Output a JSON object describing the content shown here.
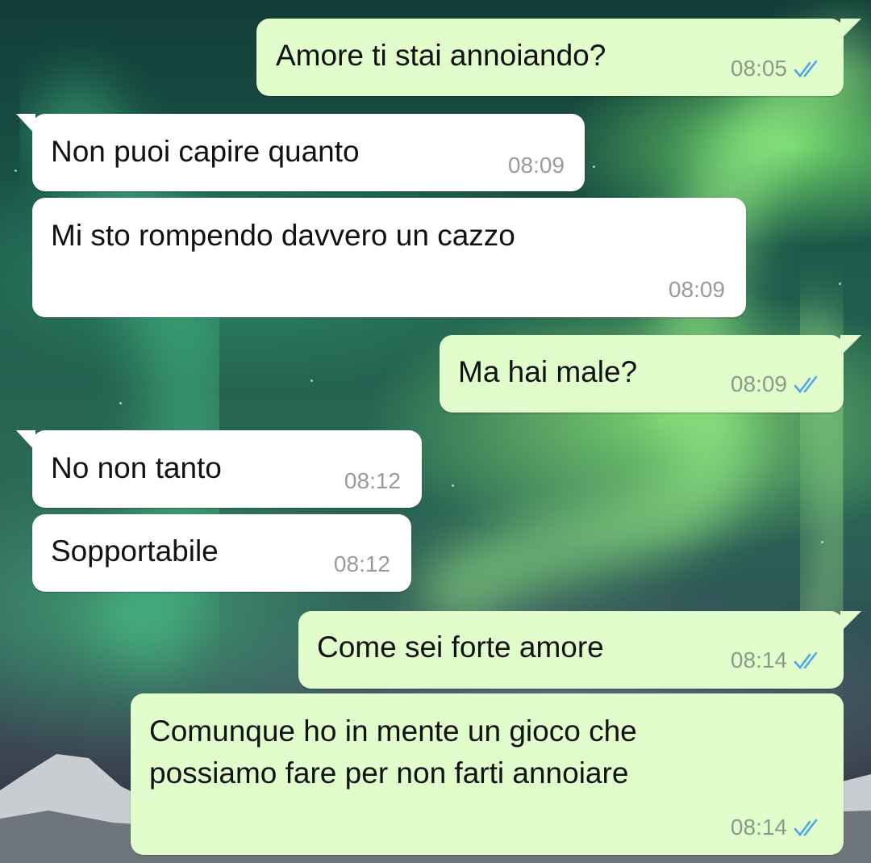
{
  "messages": [
    {
      "direction": "out",
      "text": "Amore ti stai annoiando?",
      "time": "08:05",
      "status": "read-ticks-icon"
    },
    {
      "direction": "in",
      "text": "Non puoi capire quanto",
      "time": "08:09"
    },
    {
      "direction": "in",
      "text": "Mi sto rompendo davvero un cazzo",
      "time": "08:09"
    },
    {
      "direction": "out",
      "text": "Ma hai male?",
      "time": "08:09",
      "status": "read-ticks-icon"
    },
    {
      "direction": "in",
      "text": "No non tanto",
      "time": "08:12"
    },
    {
      "direction": "in",
      "text": "Sopportabile",
      "time": "08:12"
    },
    {
      "direction": "out",
      "text": "Come sei forte amore",
      "time": "08:14",
      "status": "read-ticks-icon"
    },
    {
      "direction": "out",
      "lines": [
        "Comunque ho in mente un gioco che",
        "possiamo fare per non farti annoiare"
      ],
      "time": "08:14",
      "status": "read-ticks-icon"
    }
  ],
  "colors": {
    "outgoing_bubble": "#e1fdcb",
    "incoming_bubble": "#ffffff",
    "read_ticks": "#4fa6e8",
    "timestamp": "#8c9a8c"
  }
}
